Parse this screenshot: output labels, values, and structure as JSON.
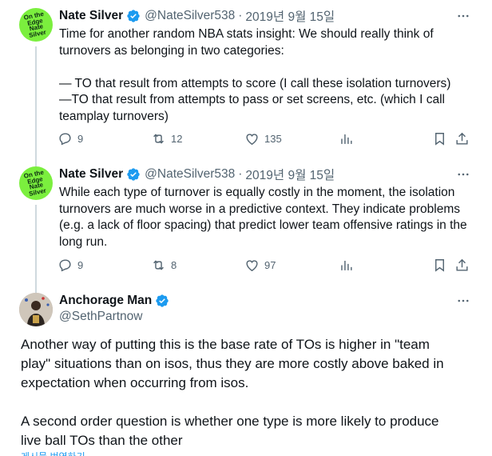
{
  "colors": {
    "accent": "#1d9bf0",
    "muted": "#536471",
    "text": "#0f1419",
    "avatar_green": "#7bef3e"
  },
  "tweets": [
    {
      "display_name": "Nate Silver",
      "handle": "@NateSilver538",
      "separator": "·",
      "date": "2019년 9월 15일",
      "avatar_logo_text": "On the\nEdge\nNate\nSilver",
      "body": "Time for another random NBA stats insight: We should really think of\nturnovers as belonging in two categories:\n\n— TO that result from attempts to score (I call these isolation turnovers)\n—TO that result from attempts to pass or set screens, etc. (which I call\nteamplay turnovers)",
      "replies": "9",
      "retweets": "12",
      "likes": "135"
    },
    {
      "display_name": "Nate Silver",
      "handle": "@NateSilver538",
      "separator": "·",
      "date": "2019년 9월 15일",
      "avatar_logo_text": "On the\nEdge\nNate\nSilver",
      "body": "While each type of turnover is equally costly in the moment, the isolation\nturnovers are much worse in a predictive context. They indicate problems\n(e.g. a lack of floor spacing) that predict lower team offensive ratings in the\nlong run.",
      "replies": "9",
      "retweets": "8",
      "likes": "97"
    }
  ],
  "main_tweet": {
    "display_name": "Anchorage Man",
    "handle": "@SethPartnow",
    "body": "Another way of putting this is the base rate of TOs is higher in \"team\nplay\" situations than on isos, thus they are more costly above baked in\nexpectation when occurring from isos.\n\nA second order question is whether one type is more likely to produce\nlive ball TOs than the other",
    "translate_label": "게시물 번역하기"
  },
  "icons": {
    "more": "more-horizontal-icon",
    "reply": "reply-icon",
    "retweet": "retweet-icon",
    "like": "heart-icon",
    "views": "analytics-icon",
    "bookmark": "bookmark-icon",
    "share": "share-icon",
    "verified": "verified-badge-icon"
  }
}
